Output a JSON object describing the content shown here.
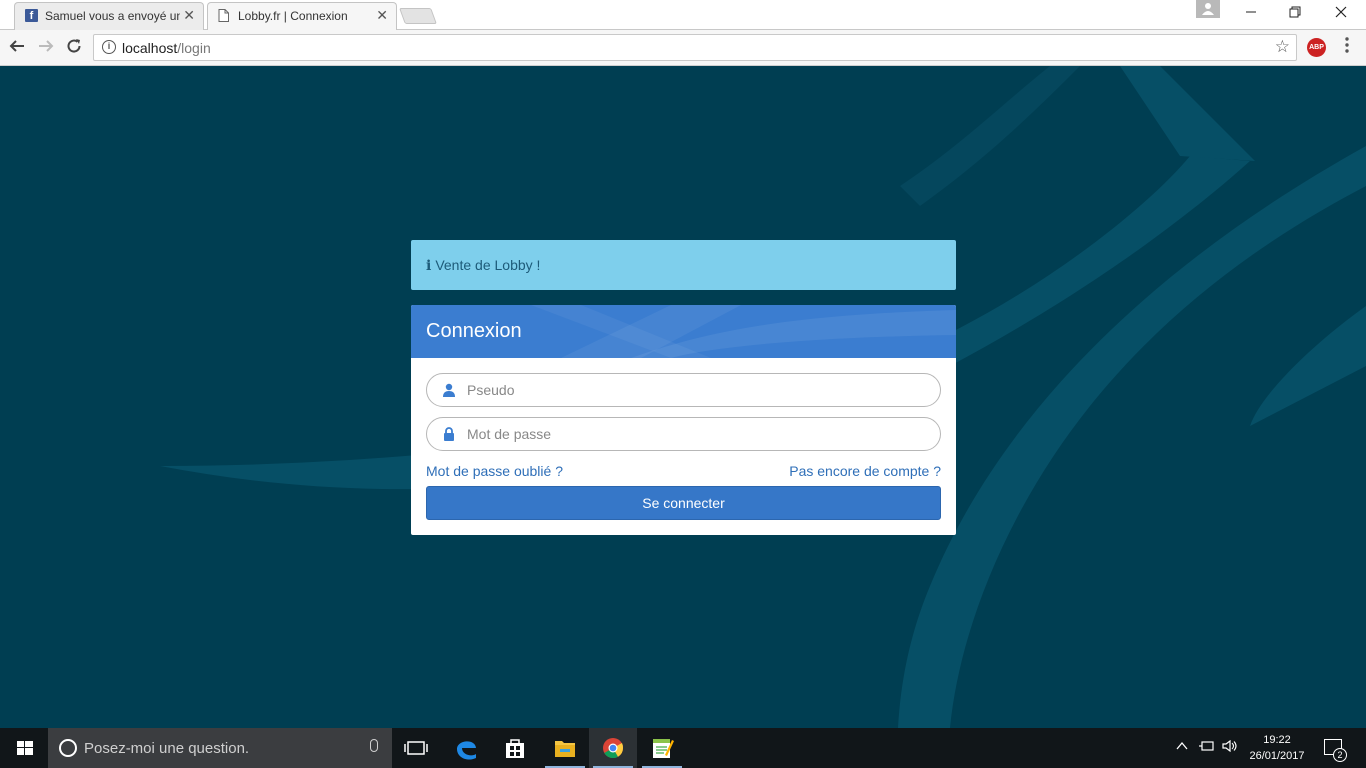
{
  "browser": {
    "tabs": [
      {
        "title": "Samuel vous a envoyé un",
        "favicon": "facebook-icon",
        "active": false
      },
      {
        "title": "Lobby.fr | Connexion",
        "favicon": "page-icon",
        "active": true
      }
    ],
    "url_host": "localhost",
    "url_path": "/login",
    "extension_label": "ABP"
  },
  "alert": {
    "icon": "info-icon",
    "text": "Vente de Lobby !"
  },
  "login": {
    "title": "Connexion",
    "username_placeholder": "Pseudo",
    "password_placeholder": "Mot de passe",
    "forgot_link": "Mot de passe oublié ?",
    "register_link": "Pas encore de compte ?",
    "submit_label": "Se connecter"
  },
  "colors": {
    "page_bg": "#003e52",
    "alert_bg": "#7ecfec",
    "panel_header": "#3b7dd0",
    "button": "#3677c8",
    "link": "#2f6fb8"
  },
  "taskbar": {
    "search_placeholder": "Posez-moi une question.",
    "time": "19:22",
    "date": "26/01/2017",
    "notification_count": "2",
    "apps": [
      "task-view-icon",
      "edge-icon",
      "store-icon",
      "file-explorer-icon",
      "chrome-icon",
      "notepad-app-icon"
    ]
  }
}
